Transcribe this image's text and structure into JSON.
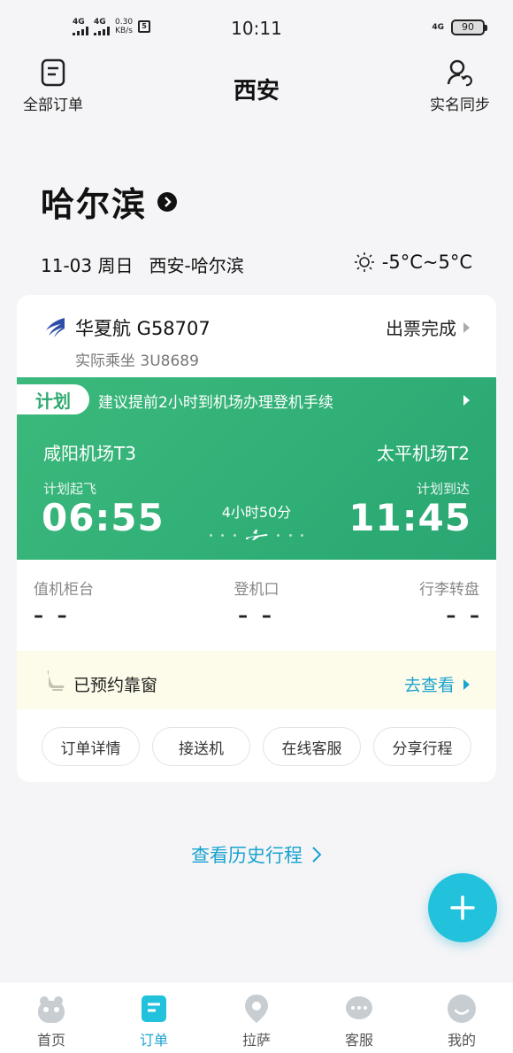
{
  "status_bar": {
    "network1": "4G",
    "network2": "4G",
    "speed_value": "0.30",
    "speed_unit": "KB/s",
    "time": "10:11",
    "network3": "4G",
    "battery": "90"
  },
  "header": {
    "left_label": "全部订单",
    "title": "西安",
    "right_label": "实名同步"
  },
  "destination": {
    "city": "哈尔滨",
    "date": "11-03 周日",
    "route": "西安-哈尔滨",
    "weather": "-5°C~5°C"
  },
  "flight": {
    "airline_flight": "华夏航 G58707",
    "actual_operator": "实际乘坐 3U8689",
    "status": "出票完成",
    "plan_tag": "计划",
    "plan_tip": "建议提前2小时到机场办理登机手续",
    "dep_airport": "咸阳机场T3",
    "arr_airport": "太平机场T2",
    "dep_label": "计划起飞",
    "arr_label": "计划到达",
    "dep_time": "06:55",
    "arr_time": "11:45",
    "duration": "4小时50分"
  },
  "info": {
    "checkin_label": "值机柜台",
    "gate_label": "登机口",
    "baggage_label": "行李转盘",
    "checkin_value": "– –",
    "gate_value": "– –",
    "baggage_value": "– –"
  },
  "seat": {
    "text": "已预约靠窗",
    "link": "去查看"
  },
  "actions": [
    "订单详情",
    "接送机",
    "在线客服",
    "分享行程"
  ],
  "history_link": "查看历史行程",
  "tabs": [
    {
      "label": "首页",
      "active": false
    },
    {
      "label": "订单",
      "active": true
    },
    {
      "label": "拉萨",
      "active": false
    },
    {
      "label": "客服",
      "active": false
    },
    {
      "label": "我的",
      "active": false
    }
  ],
  "colors": {
    "accent": "#1aa3d0",
    "green": "#2fae76",
    "fab": "#22c2dd"
  }
}
